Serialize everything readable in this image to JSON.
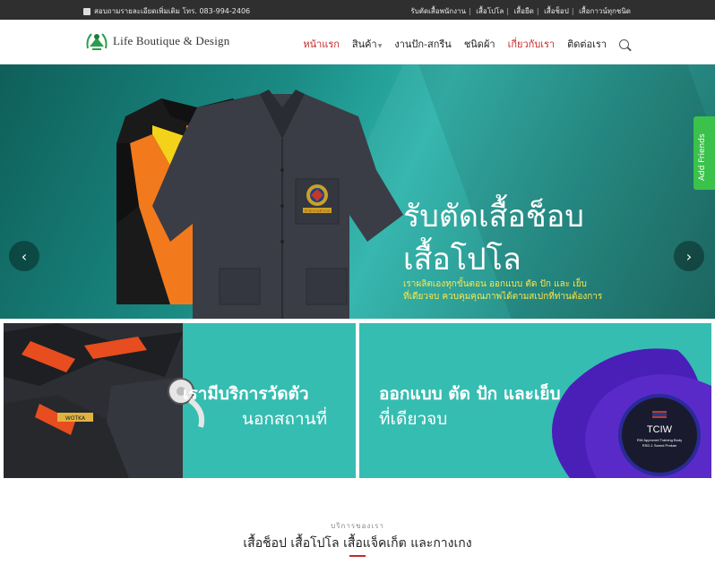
{
  "topbar": {
    "contact": "สอบถามรายละเอียดเพิ่มเติม โทร. 083-994-2406",
    "links": [
      "รับตัดเสื้อพนักงาน",
      "เสื้อโปโล",
      "เสื้อยืด",
      "เสื้อช็อป",
      "เสื้อกาวน์ทุกชนิด"
    ]
  },
  "logo": {
    "text": "Life Boutique & Design"
  },
  "nav": {
    "items": [
      "หน้าแรก",
      "สินค้า",
      "งานปัก-สกรีน",
      "ชนิดผ้า",
      "เกี่ยวกับเรา",
      "ติดต่อเรา"
    ]
  },
  "hero": {
    "title_line1": "รับตัดเสื้อช็อบ",
    "title_line2": "เสื้อโปโล",
    "sub_line1": "เราผลิตเองทุกขั้นตอน ออกแบบ ตัด ปัก และ เย็บ",
    "sub_line2": "ที่เดียวจบ ควบคุมคุณภาพได้ตามสเปกที่ท่านต้องการ",
    "prev": "‹",
    "next": "›",
    "badge_text": "สำนักงานตำรวจ"
  },
  "side_widget": {
    "label": "Add Friends"
  },
  "panels": [
    {
      "line1": "เรามีบริการวัดตัว",
      "line2": "นอกสถานที่",
      "label_tag": "WOTKA"
    },
    {
      "line1": "ออกแบบ ตัด ปัก และเย็บ",
      "line2": "ที่เดียวจบ",
      "badge_title": "TCIW",
      "badge_sub1": "RW Approved Training Body",
      "badge_sub2": "RSD-1 Samut Prakan"
    }
  ],
  "services": {
    "label": "บริการของเรา",
    "title": "เสื้อช็อป เสื้อโปโล เสื้อแจ็คเก็ต และกางเกง"
  },
  "colors": {
    "accent": "#c62828",
    "teal": "#36bdb1",
    "hero_sub": "#ffe84a",
    "line_green": "#3ac24a"
  }
}
